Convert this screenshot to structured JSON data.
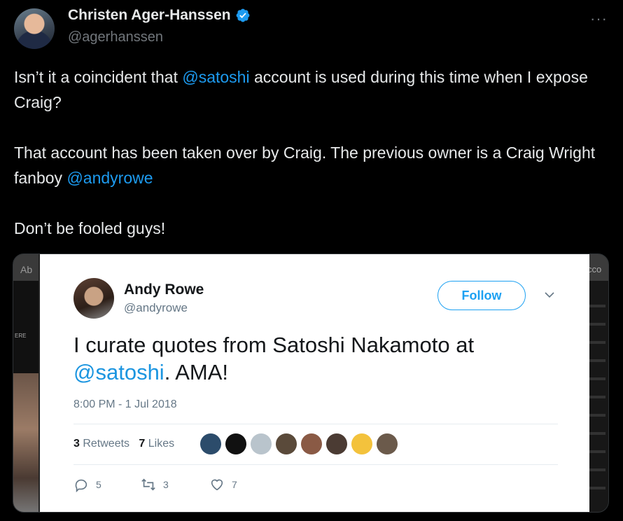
{
  "author": {
    "name": "Christen Ager-Hanssen",
    "handle": "@agerhanssen",
    "more": "···"
  },
  "tweet": {
    "line1_a": "Isn’t it a coincident that ",
    "line1_mention": "@satoshi",
    "line1_b": " account is used during this time when I expose Craig?",
    "line2_a": "That account has been taken over by Craig. The previous owner is a Craig Wright fanboy ",
    "line2_mention": "@andyrowe",
    "line3": "Don’t be fooled guys!"
  },
  "media_background": {
    "left_label": "Ab",
    "left_small": "ERE",
    "right_label": "cco"
  },
  "embedded": {
    "name": "Andy Rowe",
    "handle": "@andyrowe",
    "follow_label": "Follow",
    "text_a": "I curate quotes from Satoshi Nakamoto at ",
    "text_mention": "@satoshi",
    "text_b": ".  AMA!",
    "timestamp": "8:00 PM - 1 Jul 2018",
    "retweets_count": "3",
    "retweets_label": " Retweets",
    "likes_count": "7",
    "likes_label": " Likes",
    "replies": "5",
    "retweets": "3",
    "likes": "7",
    "liker_colors": [
      "#2c4c6b",
      "#111111",
      "#b9c4cc",
      "#5a4a3a",
      "#8a5a45",
      "#4b3b33",
      "#f3c23c",
      "#6b5a4b"
    ]
  },
  "colors": {
    "accent": "#1d9bf0",
    "card_link": "#1b95e0",
    "follow": "#1da1f2"
  }
}
